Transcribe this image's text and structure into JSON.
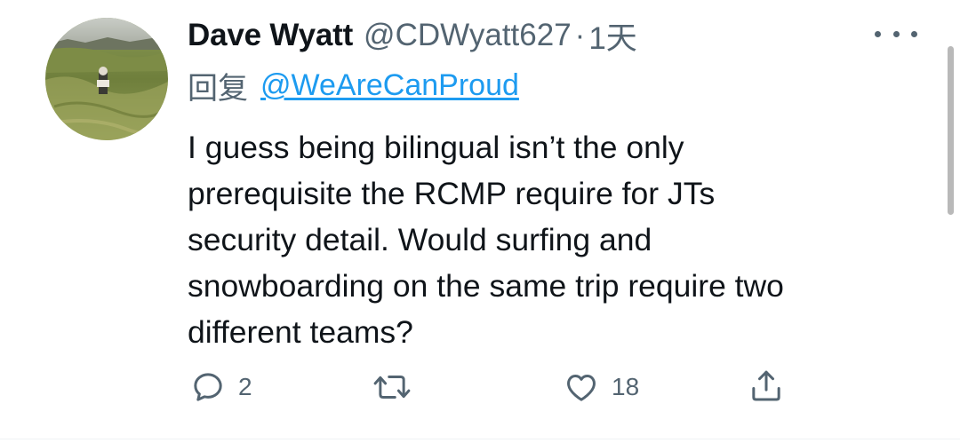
{
  "tweet": {
    "author_name": "Dave Wyatt",
    "handle": "@CDWyatt627",
    "separator": "·",
    "time": "1天",
    "reply_label": "回复",
    "reply_to": "@WeAreCanProud",
    "body_lines": [
      "I guess being bilingual isn’t the only",
      "prerequisite the RCMP require for JTs",
      "security detail. Would surfing and",
      "snowboarding on the same trip require two",
      "different teams?"
    ],
    "actions": {
      "reply_count": "2",
      "retweet_count": "",
      "like_count": "18"
    }
  },
  "icons": {
    "more": "more-dots-icon",
    "reply": "reply-bubble-icon",
    "retweet": "retweet-icon",
    "like": "heart-icon",
    "share": "share-icon"
  },
  "colors": {
    "text": "#0f1419",
    "secondary": "#536471",
    "link": "#1d9bf0",
    "background": "#ffffff"
  }
}
